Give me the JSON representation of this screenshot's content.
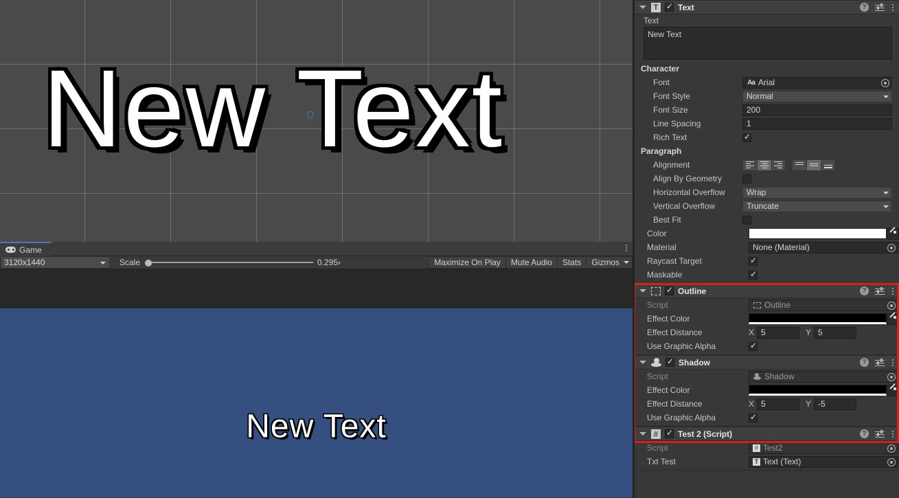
{
  "scene": {
    "text": "New Text",
    "handle_name": "pivot-handle"
  },
  "game_panel": {
    "tab_label": "Game",
    "tab_icon": "gamepad-icon",
    "resolution": "3120x1440",
    "scale_label": "Scale",
    "scale_value": "0.295›",
    "buttons": [
      {
        "label": "Maximize On Play"
      },
      {
        "label": "Mute Audio"
      },
      {
        "label": "Stats"
      },
      {
        "label": "Gizmos"
      }
    ],
    "render_text": "New Text",
    "render_bg": "#355080"
  },
  "inspector": {
    "text_component": {
      "title": "Text",
      "icon": "text-T-icon",
      "enabled": true,
      "text_label": "Text",
      "text_value": "New Text",
      "character_group": "Character",
      "font_label": "Font",
      "font_value": "Arial",
      "font_icon": "font-Aa-icon",
      "font_style_label": "Font Style",
      "font_style_value": "Normal",
      "font_size_label": "Font Size",
      "font_size_value": "200",
      "line_spacing_label": "Line Spacing",
      "line_spacing_value": "1",
      "rich_text_label": "Rich Text",
      "rich_text_on": true,
      "paragraph_group": "Paragraph",
      "alignment_label": "Alignment",
      "alignment_h_selected": 1,
      "alignment_v_selected": 1,
      "align_by_geometry_label": "Align By Geometry",
      "align_by_geometry_on": false,
      "horizontal_overflow_label": "Horizontal Overflow",
      "horizontal_overflow_value": "Wrap",
      "vertical_overflow_label": "Vertical Overflow",
      "vertical_overflow_value": "Truncate",
      "best_fit_label": "Best Fit",
      "best_fit_on": false,
      "color_label": "Color",
      "color_value": "#FFFFFF",
      "material_label": "Material",
      "material_value": "None (Material)",
      "raycast_target_label": "Raycast Target",
      "raycast_target_on": true,
      "maskable_label": "Maskable",
      "maskable_on": true
    },
    "outline_component": {
      "title": "Outline",
      "icon": "outline-square-icon",
      "enabled": true,
      "script_label": "Script",
      "script_value": "Outline",
      "effect_color_label": "Effect Color",
      "effect_color_value": "#000000",
      "effect_distance_label": "Effect Distance",
      "effect_distance_x_label": "X",
      "effect_distance_x": "5",
      "effect_distance_y_label": "Y",
      "effect_distance_y": "5",
      "use_graphic_alpha_label": "Use Graphic Alpha",
      "use_graphic_alpha_on": true
    },
    "shadow_component": {
      "title": "Shadow",
      "icon": "shadow-sphere-icon",
      "enabled": true,
      "script_label": "Script",
      "script_value": "Shadow",
      "effect_color_label": "Effect Color",
      "effect_color_value": "#000000",
      "effect_distance_label": "Effect Distance",
      "effect_distance_x_label": "X",
      "effect_distance_x": "5",
      "effect_distance_y_label": "Y",
      "effect_distance_y": "-5",
      "use_graphic_alpha_label": "Use Graphic Alpha",
      "use_graphic_alpha_on": true
    },
    "test_script_component": {
      "title": "Test 2 (Script)",
      "icon": "csharp-script-icon",
      "enabled": true,
      "script_label": "Script",
      "script_value": "Test2",
      "txt_test_label": "Txt Test",
      "txt_test_value": "Text (Text)"
    },
    "highlight_color": "#D71F1F"
  }
}
